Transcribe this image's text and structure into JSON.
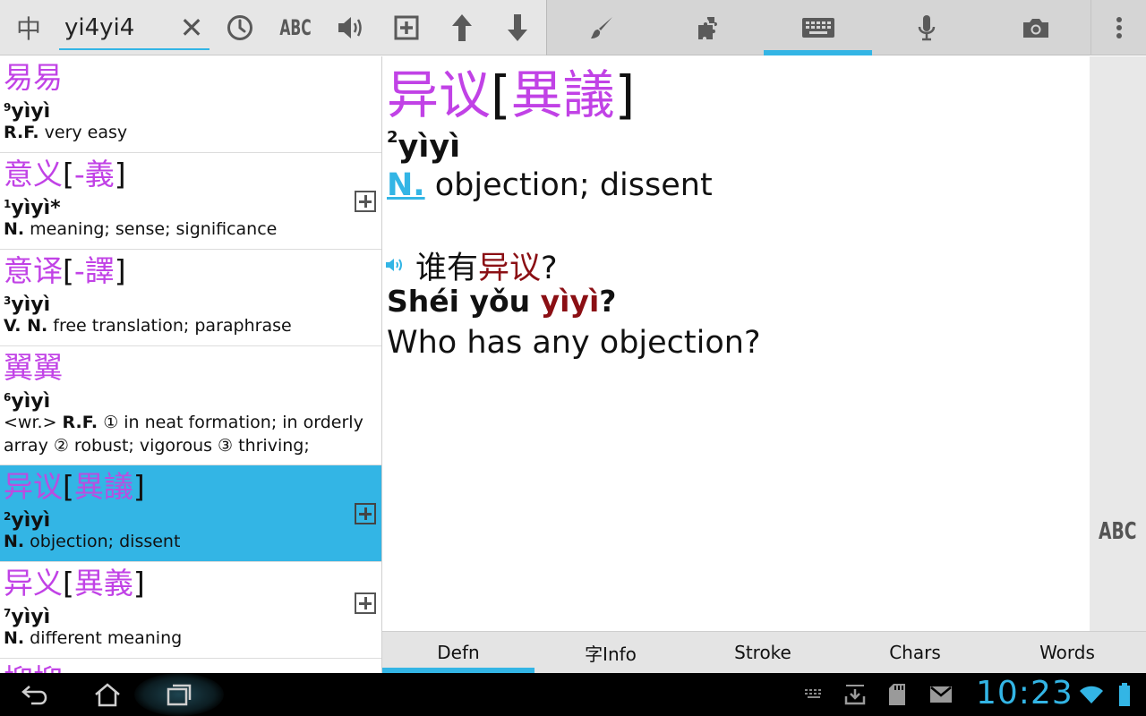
{
  "toolbar": {
    "lang_label": "中",
    "search_value": "yi4yi4",
    "clear_label": "✕",
    "abc_label": "ABC"
  },
  "results": [
    {
      "hz": "易易",
      "trad": "",
      "tone": "9",
      "pinyin": "yìyì",
      "pos": "R.F.",
      "def": "very easy",
      "add": false,
      "selected": false
    },
    {
      "hz": "意义",
      "trad": "-義",
      "tone": "1",
      "pinyin": "yìyì*",
      "pos": "N.",
      "def": "meaning; sense; significance",
      "add": true,
      "selected": false
    },
    {
      "hz": "意译",
      "trad": "-譯",
      "tone": "3",
      "pinyin": "yìyì",
      "pos": "V. N.",
      "def": "free translation; paraphrase",
      "add": false,
      "selected": false
    },
    {
      "hz": "翼翼",
      "trad": "",
      "tone": "6",
      "pinyin": "yìyì",
      "prefix": "<wr.>",
      "pos": "R.F.",
      "def": "① in neat formation; in orderly array ② robust; vigorous ③ thriving;",
      "add": false,
      "selected": false
    },
    {
      "hz": "异议",
      "trad": "異議",
      "tone": "2",
      "pinyin": "yìyì",
      "pos": "N.",
      "def": "objection; dissent",
      "add": true,
      "selected": true
    },
    {
      "hz": "异义",
      "trad": "異義",
      "tone": "7",
      "pinyin": "yìyì",
      "pos": "N.",
      "def": "different meaning",
      "add": true,
      "selected": false
    },
    {
      "hz": "抑抑",
      "trad": "",
      "tone": "",
      "pinyin": "",
      "pos": "",
      "def": "",
      "add": false,
      "selected": false
    }
  ],
  "detail": {
    "hz": "异议",
    "trad": "異議",
    "tone": "2",
    "pinyin": "yìyì",
    "pos": "N.",
    "def": "objection; dissent",
    "example": {
      "hz_before": "谁有",
      "hz_hl": "异议",
      "hz_after": "?",
      "py_before": "Shéi yǒu ",
      "py_hl": "yìyì",
      "py_after": "?",
      "en": "Who has any objection?"
    }
  },
  "side_abc": "ABC",
  "tabs": [
    "Defn",
    "字Info",
    "Stroke",
    "Chars",
    "Words"
  ],
  "active_tab": "Defn",
  "status": {
    "clock": "10:23"
  },
  "colors": {
    "accent": "#33b5e5",
    "headword": "#c142e6",
    "highlight": "#8b0f14"
  }
}
